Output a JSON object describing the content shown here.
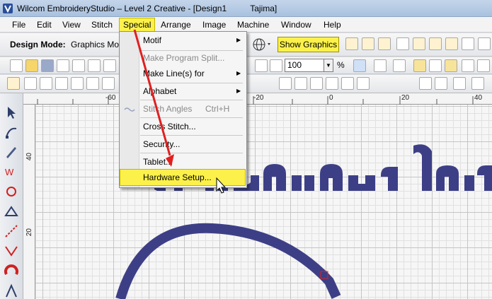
{
  "window": {
    "title": "Wilcom EmbroideryStudio – Level 2 Creative - [Design1          Tajima]"
  },
  "menubar": {
    "items": [
      "File",
      "Edit",
      "View",
      "Stitch",
      "Special",
      "Arrange",
      "Image",
      "Machine",
      "Window",
      "Help"
    ],
    "open_menu": "Special"
  },
  "toolbar": {
    "design_mode_label": "Design Mode:",
    "design_mode_value": "Graphics Mo",
    "show_graphics": "Show Graphics",
    "zoom_value": "100",
    "zoom_unit": "%"
  },
  "special_menu": {
    "items": [
      {
        "label": "Motif",
        "submenu": true,
        "disabled": false
      },
      {
        "label": "Make Program Split...",
        "disabled": true
      },
      {
        "label": "Make Line(s) for",
        "submenu": true,
        "disabled": false
      },
      {
        "label": "Alphabet",
        "submenu": true,
        "disabled": false
      },
      {
        "label": "Stitch Angles",
        "shortcut": "Ctrl+H",
        "disabled": true
      },
      {
        "label": "Cross Stitch...",
        "disabled": false
      },
      {
        "label": "Security...",
        "disabled": false
      },
      {
        "label": "Tablet...",
        "disabled": false
      },
      {
        "label": "Hardware Setup...",
        "disabled": false,
        "highlighted": true
      }
    ]
  },
  "ruler": {
    "top_labels": [
      "-60",
      "-20",
      "0",
      "20",
      "40"
    ],
    "left_labels": [
      "40",
      "20"
    ]
  },
  "colors": {
    "highlight": "#fbf14a",
    "annotation_arrow": "#e02020",
    "embroidery": "#3d3f86"
  }
}
